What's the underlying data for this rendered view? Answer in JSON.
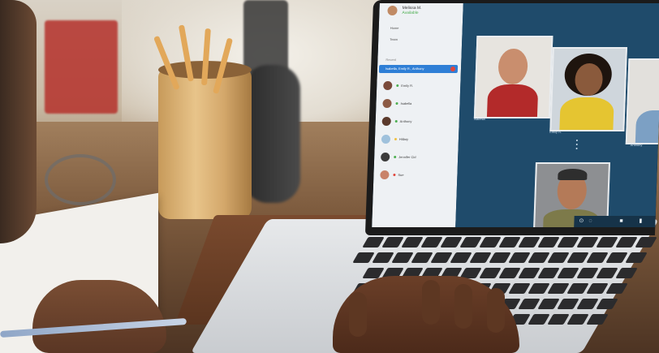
{
  "scene": {
    "description_colors": {
      "screen_bg": "#1f4b6b",
      "sidebar_bg": "#eef1f4",
      "accent": "#2f7fd6",
      "end_call": "#e0463c"
    }
  },
  "app": {
    "profile_name": "Melissa M.",
    "profile_status": "Available",
    "nav": [
      "Home",
      "Team"
    ],
    "section_label": "Recent",
    "active_chat": "Isabella, Emily R., Anthony"
  },
  "contacts": [
    {
      "name": "Emily R.",
      "status_color": "#4caf50",
      "avatar": "#7a4a3a"
    },
    {
      "name": "Isabella",
      "status_color": "#4caf50",
      "avatar": "#8c5a44"
    },
    {
      "name": "Anthony",
      "status_color": "#4caf50",
      "avatar": "#5b3a2c"
    },
    {
      "name": "Hillary",
      "status_color": "#f0c040",
      "avatar": "#9fc1dc"
    },
    {
      "name": "Jennifer Cid",
      "status_color": "#4caf50",
      "avatar": "#3b3b3b"
    },
    {
      "name": "Sue",
      "status_color": "#e0463c",
      "avatar": "#c9836a"
    }
  ],
  "video_tiles": [
    {
      "label": "Isabella"
    },
    {
      "label": "Emily R."
    },
    {
      "label": "Anthony"
    }
  ],
  "controls": {
    "chat_icon": "chat-icon",
    "video_icon": "video-icon",
    "mic_icon": "mic-icon",
    "end_icon": "phone-end-icon",
    "signal_icon": "signal-icon",
    "settings_icon": "settings-icon"
  }
}
